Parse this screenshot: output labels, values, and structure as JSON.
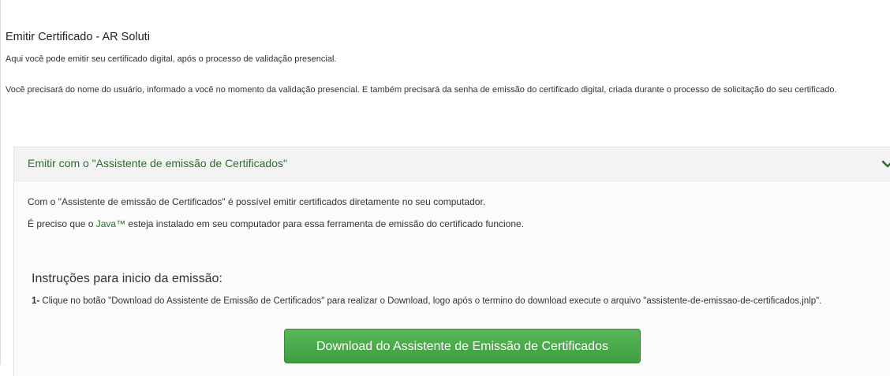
{
  "page": {
    "title": "Emitir Certificado - AR Soluti",
    "subtitle": "Aqui você pode emitir seu certificado digital, após o processo de validação presencial.",
    "paragraph": "Você precisará do nome do usuário, informado a você no momento da validação presencial. E também precisará da senha de emissão do certificado digital, criada durante o processo de solicitação do seu certificado."
  },
  "panel": {
    "header_label": "Emitir com o \"Assistente de emissão de Certificados\"",
    "header_icon": "chevron-down-icon",
    "line1": "Com o \"Assistente de emissão de Certificados\" é possível emitir certificados diretamente no seu computador.",
    "line2_prefix": "É preciso que o ",
    "line2_link": "Java™",
    "line2_suffix": " esteja instalado em seu computador para essa ferramenta de emissão do certificado funcione.",
    "instructions_title": "Instruções para inicio da emissão:",
    "step1_number": "1-",
    "step1_text": " Clique no botão \"Download do Assistente de Emissão de Certificados\" para realizar o Download, logo após o termino do download execute o arquivo \"assistente-de-emissao-de-certificados.jnlp\".",
    "download_button_label": "Download do Assistente de Emissão de Certificados"
  },
  "colors": {
    "accent_green": "#2d6b2d",
    "button_green": "#4cad4c"
  }
}
